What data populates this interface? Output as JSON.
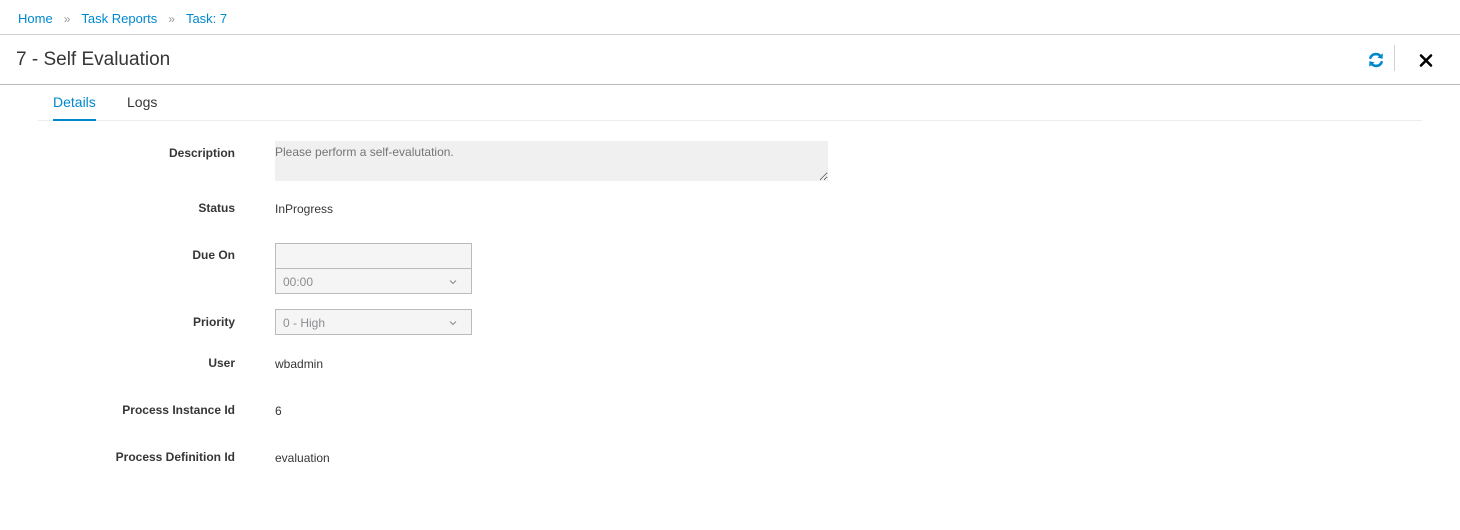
{
  "breadcrumb": {
    "items": [
      "Home",
      "Task Reports",
      "Task: 7"
    ],
    "separator": "»"
  },
  "header": {
    "title": "7 - Self Evaluation",
    "refresh_icon": "refresh-icon",
    "close_icon": "close-icon"
  },
  "tabs": [
    {
      "label": "Details",
      "active": true
    },
    {
      "label": "Logs",
      "active": false
    }
  ],
  "form": {
    "description": {
      "label": "Description",
      "placeholder": "Please perform a self-evalutation."
    },
    "status": {
      "label": "Status",
      "value": "InProgress"
    },
    "due_on": {
      "label": "Due On",
      "date_value": "",
      "time_value": "00:00"
    },
    "priority": {
      "label": "Priority",
      "value": "0 - High"
    },
    "user": {
      "label": "User",
      "value": "wbadmin"
    },
    "process_instance_id": {
      "label": "Process Instance Id",
      "value": "6"
    },
    "process_definition_id": {
      "label": "Process Definition Id",
      "value": "evaluation"
    }
  },
  "colors": {
    "accent": "#0088ce",
    "text": "#363636",
    "muted": "#8b8d8f",
    "field_bg": "#f5f5f5"
  }
}
